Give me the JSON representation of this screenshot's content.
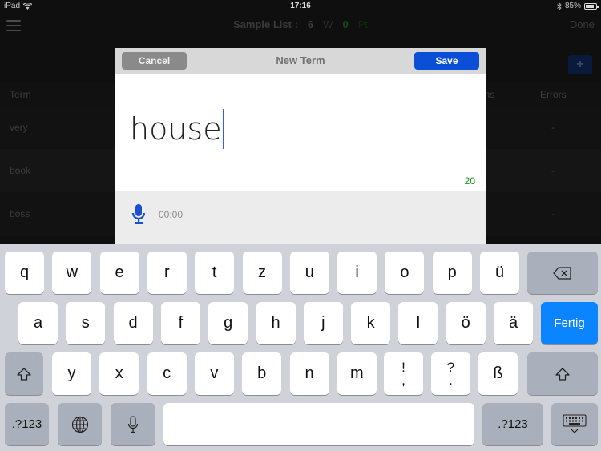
{
  "status_bar": {
    "device": "iPad",
    "time": "17:16",
    "battery": "85%",
    "battery_level": 0.85
  },
  "nav": {
    "list_title": "Sample List :",
    "word_count": "6",
    "word_label": "W",
    "points": "0",
    "points_label": "Pt",
    "done_label": "Done",
    "add_label": "+"
  },
  "list": {
    "columns": {
      "term": "Term",
      "sessions": "ons",
      "errors": "Errors"
    },
    "rows": [
      {
        "term": "very",
        "errors": "-"
      },
      {
        "term": "book",
        "errors": "-"
      },
      {
        "term": "boss",
        "errors": "-"
      }
    ]
  },
  "modal": {
    "title": "New Term",
    "cancel_label": "Cancel",
    "save_label": "Save",
    "term_value": "house",
    "remaining_chars": "20",
    "audio_time": "00:00"
  },
  "keyboard": {
    "row1": [
      "q",
      "w",
      "e",
      "r",
      "t",
      "z",
      "u",
      "i",
      "o",
      "p",
      "ü"
    ],
    "row2": [
      "a",
      "s",
      "d",
      "f",
      "g",
      "h",
      "j",
      "k",
      "l",
      "ö",
      "ä"
    ],
    "row3": [
      "y",
      "x",
      "c",
      "v",
      "b",
      "n",
      "m"
    ],
    "punct1_top": "!",
    "punct1_bottom": ",",
    "punct2_top": "?",
    "punct2_bottom": ".",
    "eszett": "ß",
    "return_label": "Fertig",
    "numbers_label": ".?123",
    "icons": {
      "backspace": "backspace-icon",
      "shift": "shift-icon",
      "globe": "globe-icon",
      "dictation": "microphone-icon",
      "dismiss": "keyboard-dismiss-icon"
    }
  }
}
